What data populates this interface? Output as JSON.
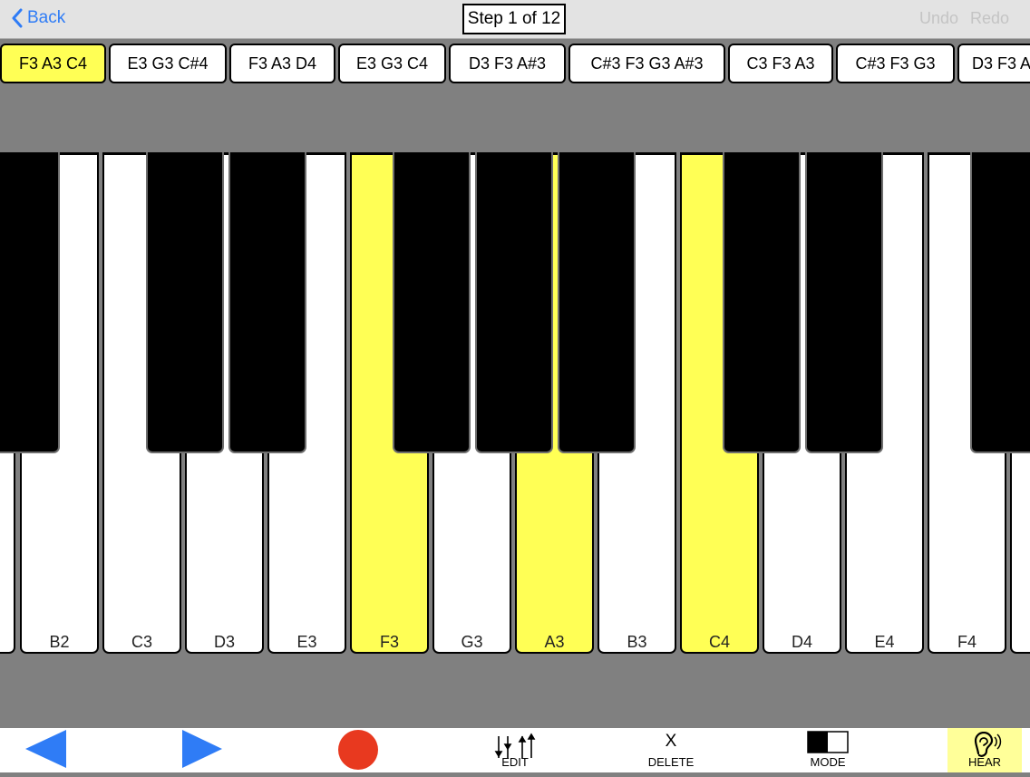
{
  "nav": {
    "back_label": "Back",
    "step_label": "Step 1 of 12",
    "undo_label": "Undo",
    "redo_label": "Redo"
  },
  "chords": [
    {
      "label": "F3 A3 C4",
      "active": true
    },
    {
      "label": "E3 G3 C#4",
      "active": false
    },
    {
      "label": "F3 A3 D4",
      "active": false
    },
    {
      "label": "E3 G3 C4",
      "active": false
    },
    {
      "label": "D3 F3 A#3",
      "active": false
    },
    {
      "label": "C#3 F3 G3 A#3",
      "active": false
    },
    {
      "label": "C3 F3 A3",
      "active": false
    },
    {
      "label": "C#3 F3 G3",
      "active": false
    },
    {
      "label": "D3 F3 A",
      "active": false
    }
  ],
  "white_keys": [
    {
      "label": "",
      "lit": false
    },
    {
      "label": "B2",
      "lit": false
    },
    {
      "label": "C3",
      "lit": false
    },
    {
      "label": "D3",
      "lit": false
    },
    {
      "label": "E3",
      "lit": false
    },
    {
      "label": "F3",
      "lit": true
    },
    {
      "label": "G3",
      "lit": false
    },
    {
      "label": "A3",
      "lit": true
    },
    {
      "label": "B3",
      "lit": false
    },
    {
      "label": "C4",
      "lit": true
    },
    {
      "label": "D4",
      "lit": false
    },
    {
      "label": "E4",
      "lit": false
    },
    {
      "label": "F4",
      "lit": false
    },
    {
      "label": "",
      "lit": false
    }
  ],
  "toolbar": {
    "prev_icon": "triangle-left-icon",
    "next_icon": "triangle-right-icon",
    "record_icon": "record-circle-icon",
    "edit_label": "EDIT",
    "delete_symbol": "X",
    "delete_label": "DELETE",
    "mode_label": "MODE",
    "hear_label": "HEAR"
  },
  "colors": {
    "highlight": "#ffff55",
    "accent_blue": "#2f7cf6",
    "record_red": "#e8391f",
    "hear_bg": "#ffff99"
  }
}
